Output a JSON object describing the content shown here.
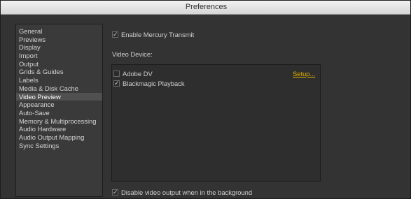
{
  "window": {
    "title": "Preferences"
  },
  "sidebar": {
    "items": [
      {
        "label": "General"
      },
      {
        "label": "Previews"
      },
      {
        "label": "Display"
      },
      {
        "label": "Import"
      },
      {
        "label": "Output"
      },
      {
        "label": "Grids & Guides"
      },
      {
        "label": "Labels"
      },
      {
        "label": "Media & Disk Cache"
      },
      {
        "label": "Video Preview",
        "selected": true
      },
      {
        "label": "Appearance"
      },
      {
        "label": "Auto-Save"
      },
      {
        "label": "Memory & Multiprocessing"
      },
      {
        "label": "Audio Hardware"
      },
      {
        "label": "Audio Output Mapping"
      },
      {
        "label": "Sync Settings"
      }
    ]
  },
  "main": {
    "enable_mercury": {
      "label": "Enable Mercury Transmit",
      "checked": true
    },
    "video_device_label": "Video Device:",
    "devices": [
      {
        "label": "Adobe DV",
        "checked": false,
        "setup_label": "Setup..."
      },
      {
        "label": "Blackmagic Playback",
        "checked": true
      }
    ],
    "disable_bg": {
      "label": "Disable video output when in the background",
      "checked": true
    }
  },
  "colors": {
    "panel_bg": "#333333",
    "selected_bg": "#505050",
    "link_color": "#e0b000"
  }
}
